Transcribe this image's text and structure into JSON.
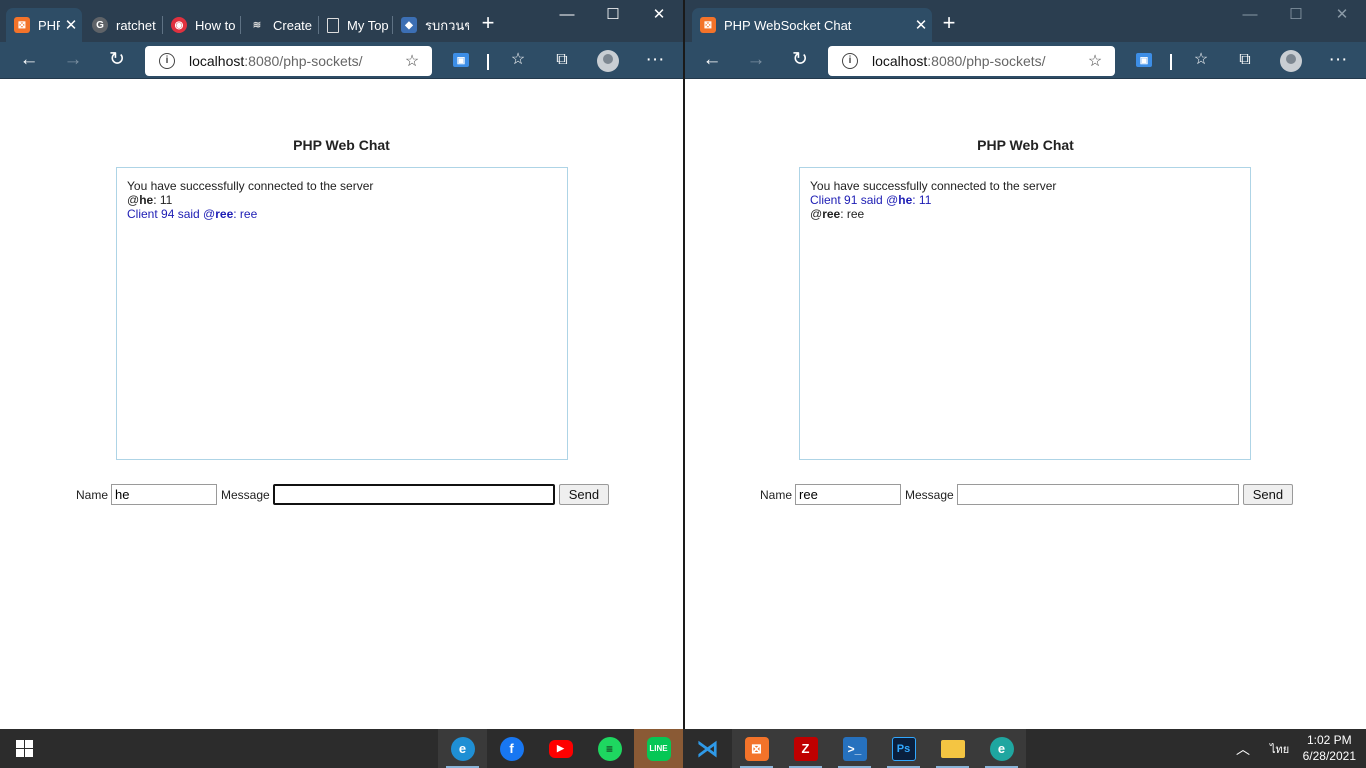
{
  "left_window": {
    "tabs": [
      {
        "label": "PHP",
        "fav": "xampp-icon",
        "active": true
      },
      {
        "label": "ratchet",
        "fav": "google-icon"
      },
      {
        "label": "How to",
        "fav": "laracasts-icon"
      },
      {
        "label": "Create",
        "fav": "stackoverflow-icon"
      },
      {
        "label": "My Top",
        "fav": "page-icon"
      },
      {
        "label": "รบกวนช",
        "fav": "thaiforum-icon"
      }
    ],
    "url_host": "localhost",
    "url_rest": ":8080/php-sockets/",
    "chat_title": "PHP Web Chat",
    "messages": [
      {
        "text": "You have successfully connected to the server",
        "blue": false
      },
      {
        "prefix": "@",
        "bold": "he",
        "suffix": ": 11",
        "blue": false
      },
      {
        "prefix": "Client 94 said @",
        "bold": "ree",
        "suffix": ": ree",
        "blue": true
      }
    ],
    "name_label": "Name",
    "name_value": "he",
    "message_label": "Message",
    "message_value": "",
    "send_label": "Send"
  },
  "right_window": {
    "tab_label": "PHP WebSocket Chat",
    "url_host": "localhost",
    "url_rest": ":8080/php-sockets/",
    "chat_title": "PHP Web Chat",
    "messages": [
      {
        "text": "You have successfully connected to the server",
        "blue": false
      },
      {
        "prefix": "Client 91 said @",
        "bold": "he",
        "suffix": ": 11",
        "blue": true
      },
      {
        "prefix": "@",
        "bold": "ree",
        "suffix": ": ree",
        "blue": false
      }
    ],
    "name_label": "Name",
    "name_value": "ree",
    "message_label": "Message",
    "message_value": "",
    "send_label": "Send"
  },
  "taskbar": {
    "apps": [
      "edge-icon",
      "facebook-icon",
      "youtube-icon",
      "spotify-icon",
      "line-icon",
      "vscode-icon",
      "xampp-icon",
      "filezilla-icon",
      "powershell-icon",
      "photoshop-icon",
      "file-explorer-icon",
      "edge-dev-icon"
    ],
    "language": "ไทย",
    "time": "1:02 PM",
    "date": "6/28/2021"
  },
  "colors": {
    "tabbar": "#2b3e50",
    "toolbar": "#2e4d66",
    "chatbox_border": "#aed4e6",
    "blue_message": "#1d1db4",
    "taskbar": "#2c2c2c"
  }
}
